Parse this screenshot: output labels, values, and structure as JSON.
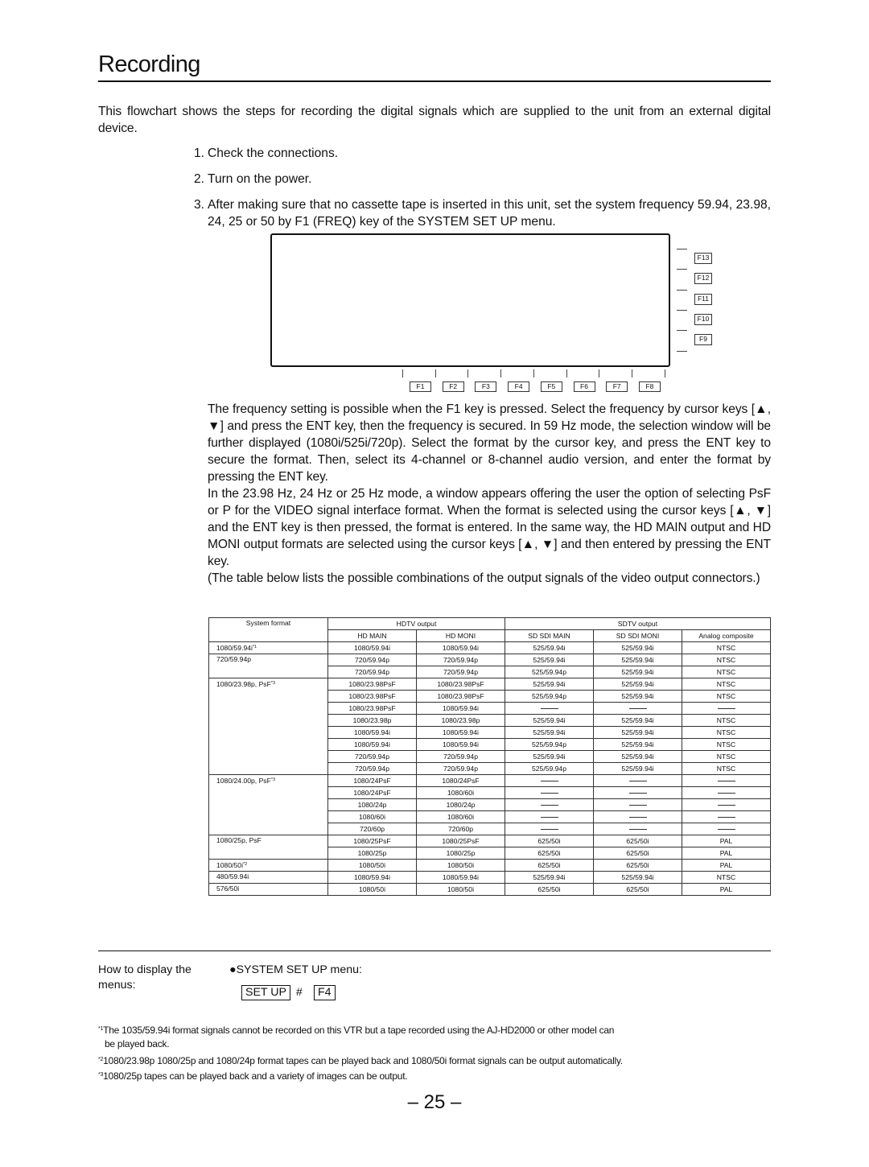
{
  "page": {
    "title": "Recording",
    "intro": "This flowchart shows the steps for recording the digital signals which are supplied to the unit from an external digital device.",
    "steps": [
      {
        "num": "1.",
        "text": "Check the connections."
      },
      {
        "num": "2.",
        "text": "Turn on the power."
      },
      {
        "num": "3.",
        "text": "After making sure that no cassette tape is inserted in this unit, set the system frequency 59.94, 23.98, 24, 25 or 50 by F1 (FREQ) key of the SYSTEM SET UP menu."
      }
    ],
    "panel": {
      "bottom_keys": [
        "F1",
        "F2",
        "F3",
        "F4",
        "F5",
        "F6",
        "F7",
        "F8"
      ],
      "side_keys": [
        "F13",
        "F12",
        "F11",
        "F10",
        "F9"
      ]
    },
    "body_paragraphs": [
      "The frequency setting is possible when the F1 key is pressed. Select the frequency by cursor keys [▲, ▼] and press the ENT key, then the frequency is secured. In 59 Hz mode, the selection window will be further displayed (1080i/525i/720p). Select the format by the cursor key, and press the ENT key to secure the format. Then, select its 4-channel or 8-channel audio version, and enter the format by pressing the ENT key.",
      "In the 23.98 Hz, 24 Hz or 25 Hz mode, a window appears offering the user the option of selecting PsF or P for the VIDEO signal interface format. When the format is selected using the cursor keys [▲, ▼] and the ENT key is then pressed, the format is entered. In the same way, the HD MAIN output and HD MONI output formats are selected using the cursor keys [▲, ▼] and then entered by pressing the ENT key.",
      "(The table below lists the possible combinations of the output signals of the video output connectors.)"
    ],
    "table": {
      "header_system": "System format",
      "header_hdtv": "HDTV output",
      "header_sdtv": "SDTV output",
      "subheaders": [
        "HD MAIN",
        "HD MONI",
        "SD SDI MAIN",
        "SD SDI MONI",
        "Analog composite"
      ],
      "groups": [
        {
          "system": "1080/59.94i",
          "note": "*1",
          "rows": [
            [
              "1080/59.94i",
              "1080/59.94i",
              "525/59.94i",
              "525/59.94i",
              "NTSC"
            ]
          ]
        },
        {
          "system": "720/59.94p",
          "note": "",
          "rows": [
            [
              "720/59.94p",
              "720/59.94p",
              "525/59.94i",
              "525/59.94i",
              "NTSC"
            ],
            [
              "720/59.94p",
              "720/59.94p",
              "525/59.94p",
              "525/59.94i",
              "NTSC"
            ]
          ]
        },
        {
          "system": "1080/23.98p, PsF",
          "note": "*3",
          "rows": [
            [
              "1080/23.98PsF",
              "1080/23.98PsF",
              "525/59.94i",
              "525/59.94i",
              "NTSC"
            ],
            [
              "1080/23.98PsF",
              "1080/23.98PsF",
              "525/59.94p",
              "525/59.94i",
              "NTSC"
            ],
            [
              "1080/23.98PsF",
              "1080/59.94i",
              "—",
              "—",
              "—"
            ],
            [
              "1080/23.98p",
              "1080/23.98p",
              "525/59.94i",
              "525/59.94i",
              "NTSC"
            ],
            [
              "1080/59.94i",
              "1080/59.94i",
              "525/59.94i",
              "525/59.94i",
              "NTSC"
            ],
            [
              "1080/59.94i",
              "1080/59.94i",
              "525/59.94p",
              "525/59.94i",
              "NTSC"
            ],
            [
              "720/59.94p",
              "720/59.94p",
              "525/59.94i",
              "525/59.94i",
              "NTSC"
            ],
            [
              "720/59.94p",
              "720/59.94p",
              "525/59.94p",
              "525/59.94i",
              "NTSC"
            ]
          ]
        },
        {
          "system": "1080/24.00p, PsF",
          "note": "*3",
          "rows": [
            [
              "1080/24PsF",
              "1080/24PsF",
              "—",
              "—",
              "—"
            ],
            [
              "1080/24PsF",
              "1080/60i",
              "—",
              "—",
              "—"
            ],
            [
              "1080/24p",
              "1080/24p",
              "—",
              "—",
              "—"
            ],
            [
              "1080/60i",
              "1080/60i",
              "—",
              "—",
              "—"
            ],
            [
              "720/60p",
              "720/60p",
              "—",
              "—",
              "—"
            ]
          ]
        },
        {
          "system": "1080/25p, PsF",
          "note": "",
          "rows": [
            [
              "1080/25PsF",
              "1080/25PsF",
              "625/50i",
              "625/50i",
              "PAL"
            ],
            [
              "1080/25p",
              "1080/25p",
              "625/50i",
              "625/50i",
              "PAL"
            ]
          ]
        },
        {
          "system": "1080/50i",
          "note": "*2",
          "rows": [
            [
              "1080/50i",
              "1080/50i",
              "625/50i",
              "625/50i",
              "PAL"
            ]
          ]
        },
        {
          "system": "480/59.94i",
          "note": "",
          "rows": [
            [
              "1080/59.94i",
              "1080/59.94i",
              "525/59.94i",
              "525/59.94i",
              "NTSC"
            ]
          ]
        },
        {
          "system": "576/50i",
          "note": "",
          "rows": [
            [
              "1080/50i",
              "1080/50i",
              "625/50i",
              "625/50i",
              "PAL"
            ]
          ]
        }
      ]
    },
    "howto": {
      "label": "How to display the menus:",
      "menu": "●SYSTEM SET UP menu:",
      "key1": "SET UP",
      "sep": "#",
      "key2": "F4"
    },
    "footnotes": [
      {
        "mark": "*1",
        "text": "The 1035/59.94i format signals cannot be recorded on this VTR but a tape recorded using the AJ-HD2000 or other model can",
        "cont": "be played back."
      },
      {
        "mark": "*2",
        "text": "1080/23.98p 1080/25p and 1080/24p format tapes can be played back and 1080/50i format signals can be output automatically."
      },
      {
        "mark": "*3",
        "text": "1080/25p tapes can be played back and a variety of images can be output."
      }
    ],
    "page_number": "– 25 –"
  }
}
